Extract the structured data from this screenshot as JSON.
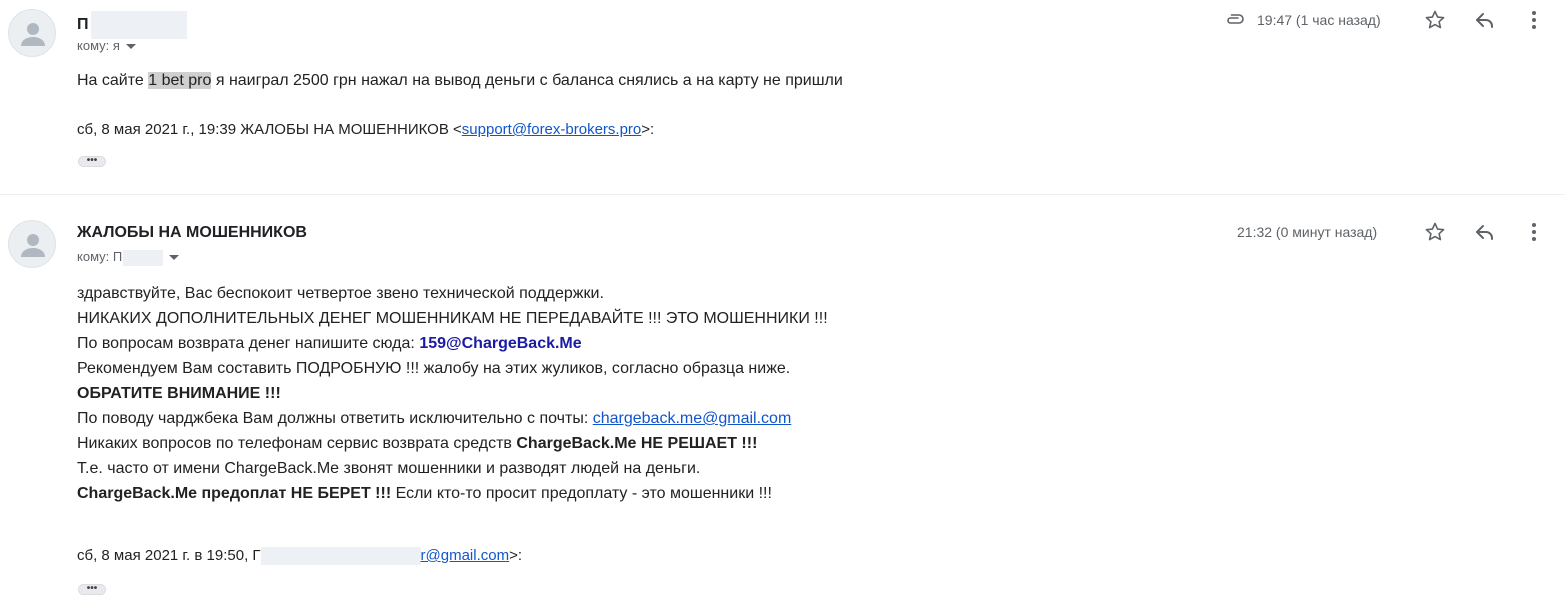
{
  "messages": [
    {
      "sender": "П",
      "recipient_prefix": "кому:",
      "recipient": "я",
      "timestamp": "19:47 (1 час назад)",
      "body_prefix": "На сайте ",
      "body_highlight": "1 bet pro",
      "body_suffix": " я наиграл 2500 грн нажал на вывод деньги с баланса снялись а на карту не пришли",
      "quote_prefix": "сб, 8 мая 2021 г., 19:39 ЖАЛОБЫ НА МОШЕННИКОВ <",
      "quote_email": "support@forex-brokers.pro",
      "quote_suffix": ">:",
      "has_attachment": true
    },
    {
      "sender": "ЖАЛОБЫ НА МОШЕННИКОВ",
      "recipient_prefix": "кому:",
      "recipient": "П",
      "timestamp": "21:32 (0 минут назад)",
      "lines": {
        "l1": "здравствуйте, Вас беспокоит четвертое звено технической поддержки.",
        "l2": "НИКАКИХ ДОПОЛНИТЕЛЬНЫХ ДЕНЕГ МОШЕННИКАМ НЕ ПЕРЕДАВАЙТЕ !!! ЭТО МОШЕННИКИ !!!",
        "l3_prefix": "По вопросам возврата денег напишите сюда: ",
        "l3_email": "159@ChargeBack.Me",
        "l4": "Рекомендуем Вам составить ПОДРОБНУЮ !!! жалобу на этих жуликов, согласно образца ниже.",
        "l5": "ОБРАТИТЕ ВНИМАНИЕ !!!",
        "l6_prefix": "По поводу чарджбека Вам должны ответить исключительно с почты: ",
        "l6_email": "chargeback.me@gmail.com",
        "l7_prefix": "Никаких вопросов по телефонам сервис возврата средств ",
        "l7_bold": "ChargeBack.Me НЕ РЕШАЕТ !!!",
        "l8": "Т.е. часто от имени ChargeBack.Me звонят мошенники и разводят людей на деньги.",
        "l9_bold": "ChargeBack.Me предоплат НЕ БЕРЕТ !!!",
        "l9_suffix": " Если кто-то просит предоплату - это мошенники !!!"
      },
      "quote_prefix": "сб, 8 мая 2021 г. в 19:50, Г",
      "quote_email": "r@gmail.com",
      "quote_suffix": ">:"
    }
  ],
  "colors": {
    "link": "#1155cc",
    "email_bold_blue": "#1a1aa6",
    "meta_gray": "#5f6368",
    "highlight": "#cfcfcf"
  },
  "icons": [
    "avatar-icon",
    "paperclip-icon",
    "star-icon",
    "reply-icon",
    "more-vert-icon",
    "caret-down-icon",
    "ellipsis-icon"
  ]
}
